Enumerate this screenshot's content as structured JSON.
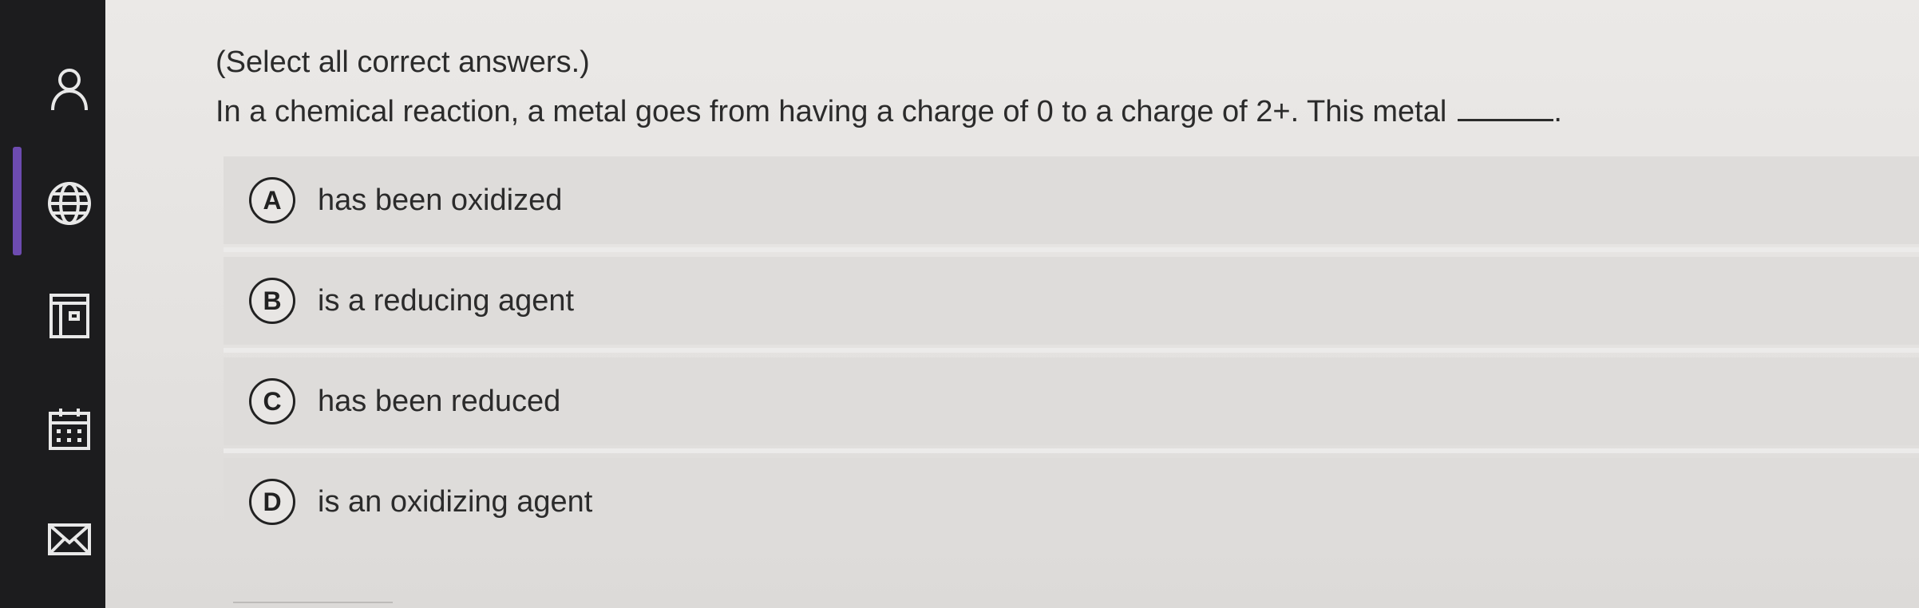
{
  "sidebar": {
    "icons": [
      {
        "name": "profile-icon"
      },
      {
        "name": "globe-icon"
      },
      {
        "name": "courses-icon"
      },
      {
        "name": "calendar-icon"
      },
      {
        "name": "messages-icon"
      }
    ],
    "active_index": 1
  },
  "question": {
    "instructions": "(Select all correct answers.)",
    "prompt": "In a chemical reaction, a metal goes from having a charge of 0 to a charge of 2+. This metal",
    "prompt_end": "."
  },
  "options": [
    {
      "letter": "A",
      "text": "has been oxidized"
    },
    {
      "letter": "B",
      "text": "is a reducing agent"
    },
    {
      "letter": "C",
      "text": "has been reduced"
    },
    {
      "letter": "D",
      "text": "is an oxidizing agent"
    }
  ],
  "colors": {
    "sidebar_bg": "#1c1c1e",
    "active_indicator": "#6d4bb0",
    "page_bg": "#e6e4e2",
    "option_bg": "#dedcda"
  }
}
